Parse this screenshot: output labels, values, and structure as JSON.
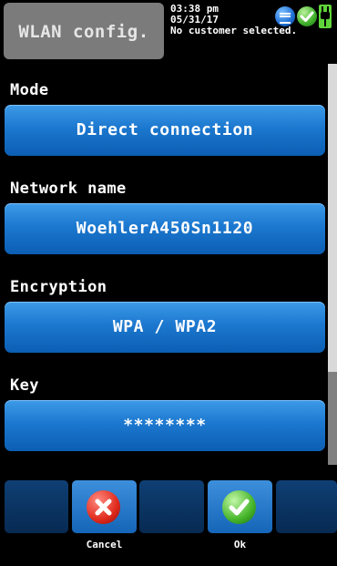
{
  "header": {
    "title": "WLAN config.",
    "time": "03:38 pm",
    "date": "05/31/17",
    "customer": "No customer selected."
  },
  "icons": {
    "wlan": "wlan-status-icon",
    "ok": "check-status-icon",
    "power": "power-plug-icon"
  },
  "fields": {
    "mode": {
      "label": "Mode",
      "value": "Direct connection"
    },
    "network": {
      "label": "Network name",
      "value": "WoehlerA450Sn1120"
    },
    "encryption": {
      "label": "Encryption",
      "value": "WPA / WPA2"
    },
    "key": {
      "label": "Key",
      "value": "********"
    }
  },
  "footer": {
    "cancel_label": "Cancel",
    "ok_label": "Ok"
  },
  "colors": {
    "button_blue": "#1c78cf",
    "header_gray": "#7b7b7b",
    "cancel_red": "#e02a1c",
    "ok_green": "#46b52a"
  }
}
